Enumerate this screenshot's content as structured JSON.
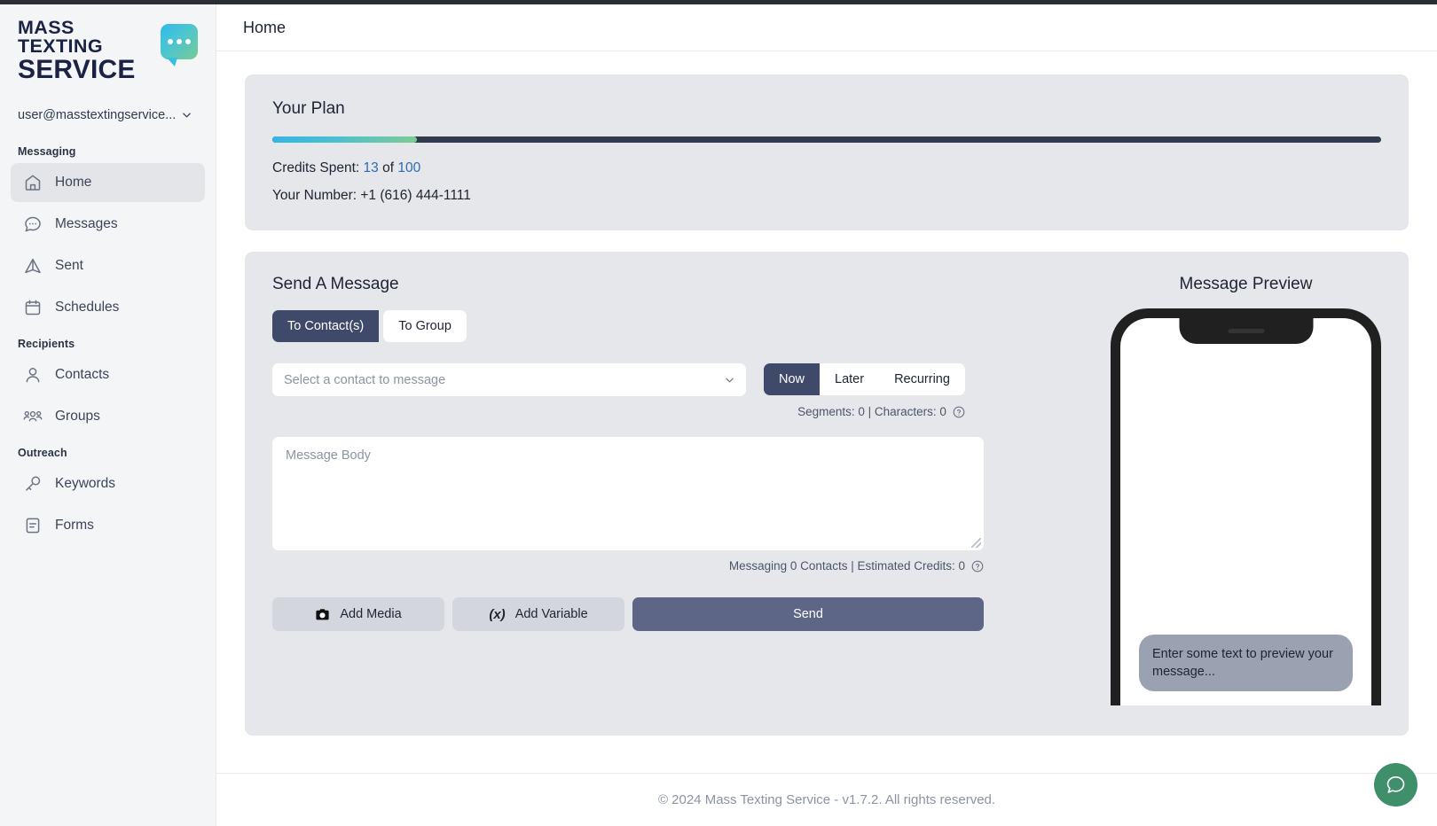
{
  "sidebar": {
    "logo": {
      "line1": "MASS TEXTING",
      "line2": "SERVICE",
      "icon": "speech-bubble-icon"
    },
    "account": {
      "email": "user@masstextingservice...",
      "chevron": "chevron-down-icon"
    },
    "sections": [
      {
        "label": "Messaging",
        "items": [
          {
            "label": "Home",
            "icon": "home-icon",
            "active": true
          },
          {
            "label": "Messages",
            "icon": "chat-bubble-icon",
            "active": false
          },
          {
            "label": "Sent",
            "icon": "send-triangle-icon",
            "active": false
          },
          {
            "label": "Schedules",
            "icon": "calendar-icon",
            "active": false
          }
        ]
      },
      {
        "label": "Recipients",
        "items": [
          {
            "label": "Contacts",
            "icon": "person-icon",
            "active": false
          },
          {
            "label": "Groups",
            "icon": "people-group-icon",
            "active": false
          }
        ]
      },
      {
        "label": "Outreach",
        "items": [
          {
            "label": "Keywords",
            "icon": "key-icon",
            "active": false
          },
          {
            "label": "Forms",
            "icon": "document-icon",
            "active": false
          }
        ]
      }
    ]
  },
  "header": {
    "title": "Home"
  },
  "plan": {
    "title": "Your Plan",
    "progress_percent": 13,
    "credits_label": "Credits Spent: ",
    "credits_spent": "13",
    "credits_of": " of ",
    "credits_total": "100",
    "number_label": "Your Number: ",
    "number_value": "+1 (616) 444-1111"
  },
  "send": {
    "title": "Send A Message",
    "recipient_tabs": [
      {
        "label": "To Contact(s)",
        "active": true
      },
      {
        "label": "To Group",
        "active": false
      }
    ],
    "select_placeholder": "Select a contact to message",
    "select_chevron": "chevron-down-icon",
    "timing_tabs": [
      {
        "label": "Now",
        "active": true
      },
      {
        "label": "Later",
        "active": false
      },
      {
        "label": "Recurring",
        "active": false
      }
    ],
    "counter_text": "Segments: 0  |  Characters: 0",
    "counter_help_icon": "help-circle-icon",
    "body_placeholder": "Message Body",
    "estimate_text": "Messaging 0 Contacts  |  Estimated Credits: 0",
    "estimate_help_icon": "help-circle-icon",
    "add_media_label": "Add Media",
    "add_media_icon": "camera-icon",
    "add_variable_label": "Add Variable",
    "add_variable_glyph": "(x)",
    "send_label": "Send"
  },
  "preview": {
    "title": "Message Preview",
    "bubble_text": "Enter some text to preview your message..."
  },
  "footer": {
    "text": "© 2024 Mass Texting Service - v1.7.2. All rights reserved."
  },
  "chat_widget": {
    "icon": "chat-bubble-icon"
  },
  "colors": {
    "accent_link": "#2b6cb0",
    "active_tab": "#3f4a6b",
    "send_button": "#5d6687",
    "progress_start": "#33b5e5",
    "progress_end": "#7ecb92",
    "card_bg": "#e5e7eb",
    "chat_fab": "#3f8f6b"
  }
}
